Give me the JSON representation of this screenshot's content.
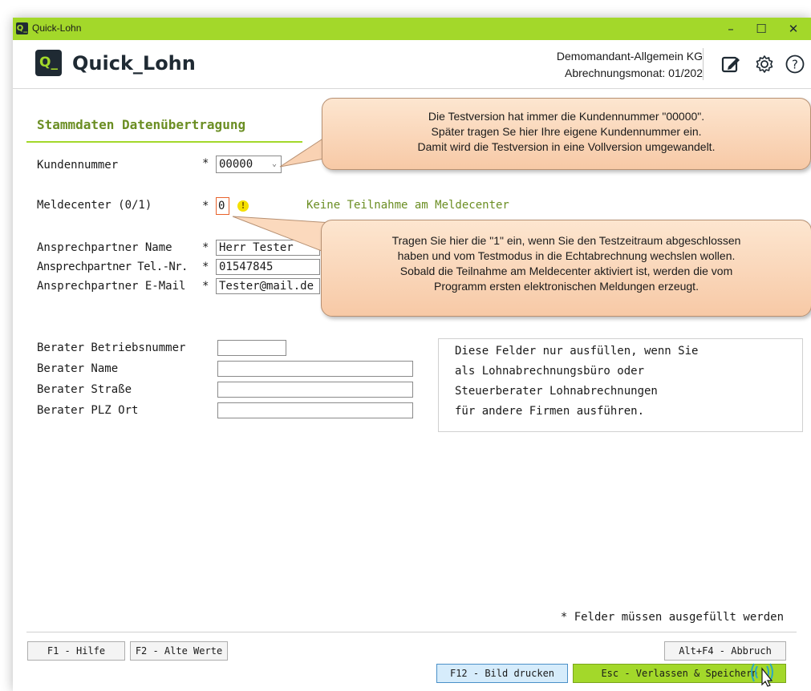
{
  "window": {
    "title": "Quick-Lohn",
    "app_badge": "Q_"
  },
  "header": {
    "logo": "Q_",
    "brand": "Quick_Lohn",
    "company": "Demomandant-Allgemein KG",
    "period": "Abrechnungsmonat: 01/202",
    "icons": [
      "edit-icon",
      "gear-icon",
      "help-icon"
    ]
  },
  "section_title": "Stammdaten Datenübertragung",
  "fields": {
    "kundennummer": {
      "label": "Kundennummer",
      "required": "*",
      "value": "00000"
    },
    "meldecenter": {
      "label": "Meldecenter (0/1)",
      "required": "*",
      "value": "0",
      "status": "Keine Teilnahme am Meldecenter"
    },
    "ansprech_name": {
      "label": "Ansprechpartner Name",
      "required": "*",
      "value": "Herr Tester"
    },
    "ansprech_tel": {
      "label": "Ansprechpartner Tel.-Nr.",
      "required": "*",
      "value": "01547845"
    },
    "ansprech_mail": {
      "label": "Ansprechpartner E-Mail",
      "required": "*",
      "value": "Tester@mail.de"
    },
    "berater_nr": {
      "label": "Berater Betriebsnummer",
      "value": ""
    },
    "berater_name": {
      "label": "Berater Name",
      "value": ""
    },
    "berater_strasse": {
      "label": "Berater Straße",
      "value": ""
    },
    "berater_ort": {
      "label": "Berater PLZ Ort",
      "value": ""
    }
  },
  "berater_note": [
    "Diese Felder nur ausfüllen, wenn Sie",
    "als Lohnabrechnungsbüro oder",
    "Steuerberater Lohnabrechnungen",
    "für andere Firmen ausführen."
  ],
  "callout1": [
    "Die Testversion hat immer die Kundennummer \"00000\".",
    "Später tragen Se hier Ihre eigene Kundennummer ein.",
    "Damit wird die Testversion in eine Vollversion umgewandelt."
  ],
  "callout2": [
    "Tragen Sie hier die \"1\" ein, wenn Sie den Testzeitraum abgeschlossen",
    "haben und vom Testmodus in die Echtabrechnung wechslen wollen.",
    "Sobald die Teilnahme am Meldecenter aktiviert ist, werden die vom",
    "Programm ersten elektronischen Meldungen erzeugt."
  ],
  "required_note": "*  Felder müssen ausgefüllt werden",
  "buttons": {
    "help": "F1 - Hilfe",
    "old_values": "F2 - Alte Werte",
    "cancel": "Alt+F4 - Abbruch",
    "print": "F12 - Bild drucken",
    "save": "Esc - Verlassen & Speichern"
  },
  "colors": {
    "accent": "#a3d82a",
    "title_green": "#6b8e23",
    "dark": "#1f2a33",
    "callout": "#f7c9a6",
    "print_btn": "#d6ecfb"
  }
}
